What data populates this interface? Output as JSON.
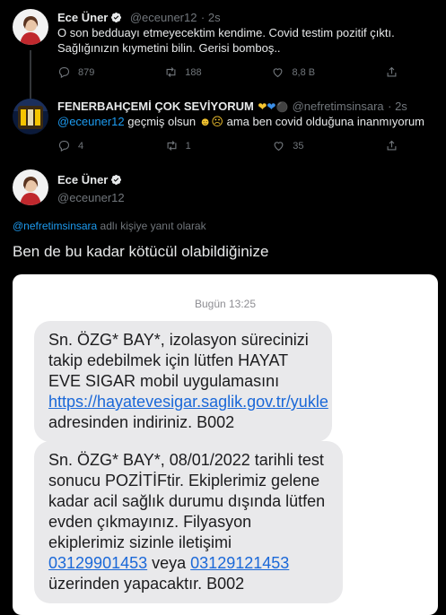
{
  "colors": {
    "accent": "#1d9bf0",
    "background": "#000000",
    "muted": "#71767b",
    "sms_bubble": "#e9e9eb"
  },
  "tweet1": {
    "name": "Ece Üner",
    "handle": "@eceuner12",
    "time": "· 2s",
    "text_line1": "O son bedduayı etmeyecektim kendime. Covid testim pozitif çıktı.",
    "text_line2": "Sağlığınızın kıymetini bilin. Gerisi bomboş..",
    "replies": "879",
    "retweets": "188",
    "likes": "8,8 B"
  },
  "reply": {
    "name": "FENERBAHÇEMİ ÇOK SEVİYORUM",
    "handle": "@nefretimsinsara",
    "time": "· 2s",
    "mention": "@eceuner12",
    "text_before": " geçmiş olsun ",
    "text_after": " ama ben covid olduğuna inanmıyorum",
    "replies": "4",
    "retweets": "1",
    "likes": "35"
  },
  "tweet2": {
    "name": "Ece Üner",
    "handle": "@eceuner12",
    "reply_to_mention": "@nefretimsinsara",
    "reply_to_suffix": " adlı kişiye yanıt olarak",
    "text": "Ben de bu kadar kötücül olabildiğinize"
  },
  "sms": {
    "date": "Bugün 13:25",
    "msg1_a": "Sn. ÖZG* BAY*, izolasyon sürecinizi takip edebilmek için lütfen HAYAT EVE SIGAR mobil uygulamasını ",
    "msg1_link": "https://hayatevesigar.saglik.gov.tr/yukle",
    "msg1_b": " adresinden indiriniz. B002",
    "msg2_a": "Sn. ÖZG* BAY*, 08/01/2022 tarihli test sonucu POZİTİFtir. Ekiplerimiz gelene kadar acil sağlık durumu dışında lütfen evden çıkmayınız. Filyasyon ekiplerimiz sizinle iletişimi ",
    "msg2_phone1": "03129901453",
    "msg2_mid": " veya ",
    "msg2_phone2": "03129121453",
    "msg2_b": " üzerinden yapacaktır. B002"
  }
}
